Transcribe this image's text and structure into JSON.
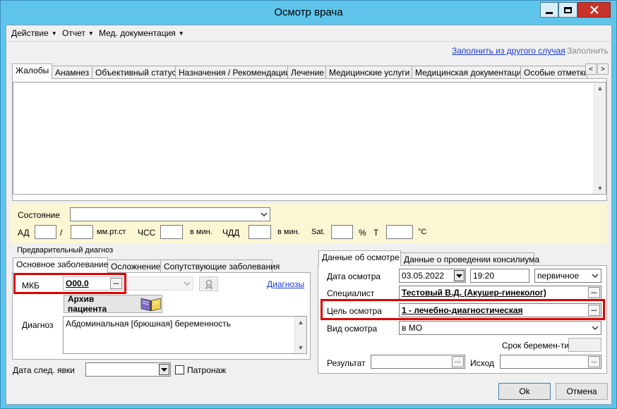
{
  "window": {
    "title": "Осмотр врача"
  },
  "menu": [
    {
      "label": "Действие"
    },
    {
      "label": "Отчет"
    },
    {
      "label": "Мед. документация"
    }
  ],
  "toolbar": {
    "fill_from_other_case": "Заполнить из другого случая",
    "fill": "Заполнить"
  },
  "top_tabs": [
    "Жалобы",
    "Анамнез",
    "Объективный статус",
    "Назначения / Рекомендации",
    "Лечение",
    "Медицинские услуги",
    "Медицинская документация",
    "Особые отметки"
  ],
  "vitals": {
    "state_label": "Состояние",
    "state_value": "",
    "ad_label": "АД",
    "slash": "/",
    "ad_unit": "мм.рт.ст",
    "chss_label": "ЧСС",
    "chss_unit": "в мин.",
    "chdd_label": "ЧДД",
    "chdd_unit": "в мин.",
    "sat_label": "Sat.",
    "sat_unit": "%",
    "t_label": "T",
    "t_unit": "°С"
  },
  "diagnosis": {
    "group_title": "Предварительный диагноз",
    "tabs": [
      "Основное заболевание",
      "Осложнение",
      "Сопутствующие заболевания"
    ],
    "mkb_label": "МКБ",
    "mkb_value": "O00.0",
    "diagnoses_link": "Диагнозы",
    "archive_button": "Архив пациента",
    "diagnosis_label": "Диагноз",
    "diagnosis_value": "Абдоминальная [брюшная] беременность"
  },
  "next_visit": {
    "label": "Дата след. явки",
    "value": "",
    "patronage_label": "Патронаж"
  },
  "exam": {
    "tabs": [
      "Данные об осмотре",
      "Данные о проведении консилиума"
    ],
    "date_label": "Дата осмотра",
    "date_value": "03.05.2022",
    "time_value": "19:20",
    "type_value": "первичное",
    "specialist_label": "Специалист",
    "specialist_value": "Тестовый В.Д. (Акушер-гинеколог)",
    "purpose_label": "Цель осмотра",
    "purpose_value": "1 - лечебно-диагностическая",
    "kind_label": "Вид осмотра",
    "kind_value": "в МО",
    "pregnancy_term_label": "Срок беремен-ти",
    "result_label": "Результат",
    "outcome_label": "Исход"
  },
  "buttons": {
    "ok": "Ok",
    "cancel": "Отмена"
  },
  "colors": {
    "titlebar": "#5ec4ea",
    "highlight": "#e00000",
    "link": "#1a3bd6",
    "vitals_bg": "#fbf6d4"
  }
}
